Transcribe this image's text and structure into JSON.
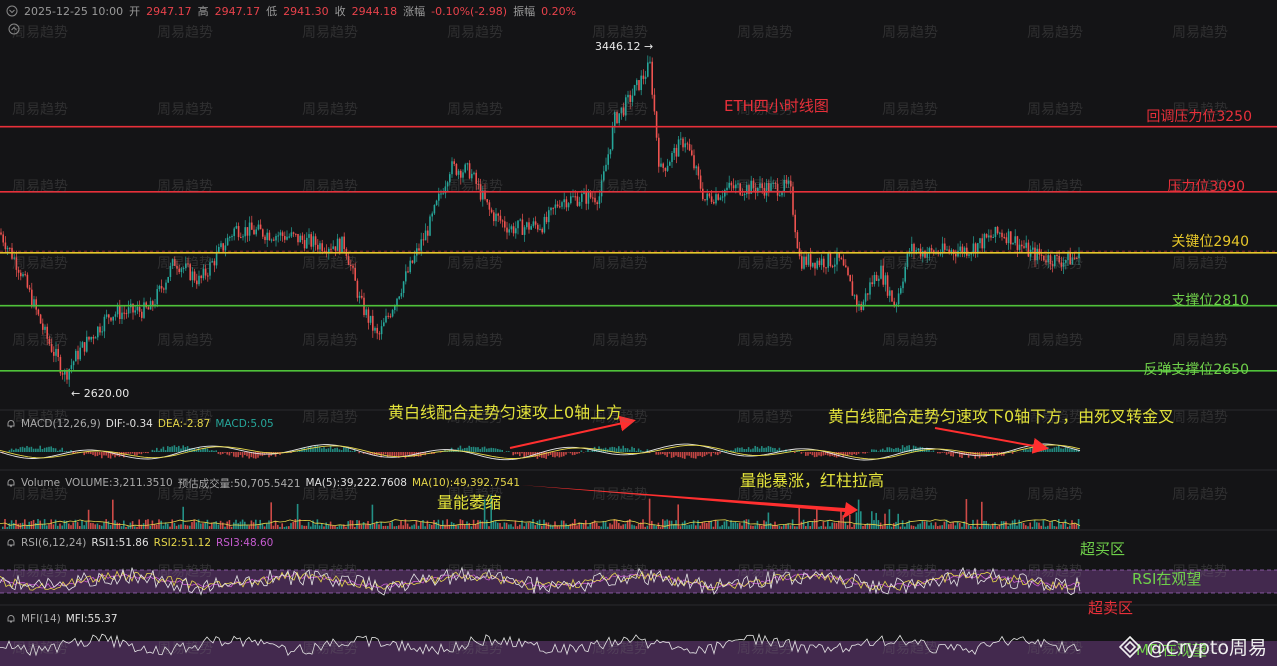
{
  "header": {
    "datetime": "2025-12-25 10:00",
    "open_label": "开",
    "open": "2947.17",
    "high_label": "高",
    "high": "2947.17",
    "low_label": "低",
    "low": "2941.30",
    "close_label": "收",
    "close": "2944.18",
    "change_label": "涨幅",
    "change": "-0.10%(-2.98)",
    "amp_label": "振幅",
    "amp": "0.20%"
  },
  "title": "ETH四小时线图",
  "levels": [
    {
      "label": "回调压力位3250",
      "price": 3250,
      "color": "#e8303a"
    },
    {
      "label": "压力位3090",
      "price": 3090,
      "color": "#e8303a"
    },
    {
      "label": "关键位2940",
      "price": 2940,
      "color": "#e6c72a"
    },
    {
      "label": "支撑位2810",
      "price": 2810,
      "color": "#4fc23a"
    },
    {
      "label": "反弹支撑位2650",
      "price": 2650,
      "color": "#4fc23a"
    }
  ],
  "markers": {
    "high": "3446.12 →",
    "low": "← 2620.00"
  },
  "macd": {
    "name": "MACD(12,26,9)",
    "dif": "DIF:-0.34",
    "dea": "DEA:-2.87",
    "macd": "MACD:5.05",
    "annotation_left": "黄白线配合走势匀速攻上0轴上方",
    "annotation_right": "黄白线配合走势匀速攻下0轴下方，由死叉转金叉"
  },
  "volume": {
    "name": "Volume",
    "vol": "VOLUME:3,211.3510",
    "est": "预估成交量:50,705.5421",
    "ma5": "MA(5):39,222.7608",
    "ma10": "MA(10):49,392.7541",
    "annotation_shrink": "量能萎缩",
    "annotation_surge": "量能暴涨，红柱拉高"
  },
  "rsi": {
    "name": "RSI(6,12,24)",
    "rsi1": "RSI1:51.86",
    "rsi2": "RSI2:51.12",
    "rsi3": "RSI3:48.60",
    "overbought": "超买区",
    "watch": "RSI在观望",
    "oversold": "超卖区"
  },
  "mfi": {
    "name": "MFI(14)",
    "value": "MFI:55.37",
    "watch": "MFI在观望"
  },
  "watermark": "周易趋势",
  "brand": "@Crypto周易",
  "colors": {
    "up": "#26a69a",
    "down": "#ef5350",
    "yellow": "#e6d74a",
    "purple": "#9a4fb8"
  }
}
